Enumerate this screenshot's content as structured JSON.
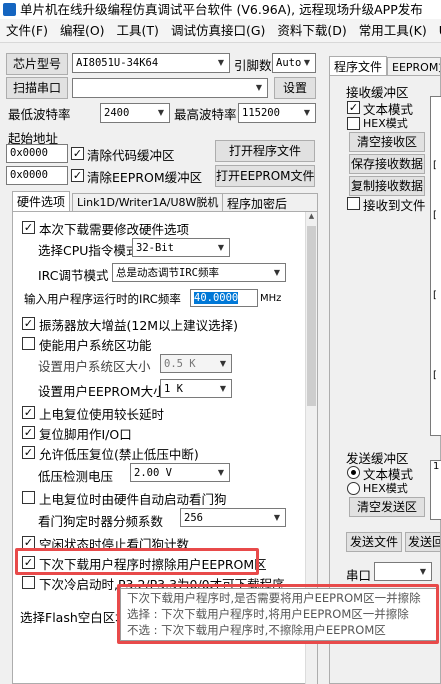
{
  "window": {
    "title": "单片机在线升级编程仿真调试平台软件 (V6.96A), 远程现场升级APP发布"
  },
  "menubar": [
    "文件(F)",
    "编程(O)",
    "工具(T)",
    "调试仿真接口(G)",
    "资料下载(D)",
    "常用工具(K)",
    "US"
  ],
  "chip": {
    "button": "芯片型号",
    "value": "AI8051U-34K64",
    "pin_label": "引脚数",
    "pin_value": "Auto"
  },
  "port": {
    "button": "扫描串口",
    "settings_button": "设置"
  },
  "baud": {
    "min_label": "最低波特率",
    "min_value": "2400",
    "max_label": "最高波特率",
    "max_value": "115200"
  },
  "addr": {
    "label": "起始地址",
    "addr1": "0x0000",
    "clear_code": "清除代码缓冲区",
    "open_program": "打开程序文件",
    "addr2": "0x0000",
    "clear_eeprom": "清除EEPROM缓冲区",
    "open_eeprom": "打开EEPROM文件"
  },
  "tabs": [
    "硬件选项",
    "Link1D/Writer1A/U8W脱机",
    "程序加密后"
  ],
  "hw": {
    "modify": "本次下载需要修改硬件选项",
    "cpu_label": "选择CPU指令模式",
    "cpu_value": "32-Bit",
    "irc_label": "IRC调节模式",
    "irc_value": "总是动态调节IRC频率",
    "freq_label": "输入用户程序运行时的IRC频率",
    "freq_value": "40.0000",
    "freq_unit": "MHz",
    "osc": "振荡器放大增益(12M以上建议选择)",
    "sysarea": "使能用户系统区功能",
    "sysarea_size_label": "设置用户系统区大小",
    "sysarea_size_value": "0.5 K",
    "eeprom_size_label": "设置用户EEPROM大小",
    "eeprom_size_value": "1  K",
    "longreset": "上电复位使用较长延时",
    "resetio": "复位脚用作I/O口",
    "lowvolt": "允许低压复位(禁止低压中断)",
    "lowvolt_label": "低压检测电压",
    "lowvolt_value": "2.00 V",
    "wdt_start": "上电复位时由硬件自动启动看门狗",
    "wdt_div_label": "看门狗定时器分频系数",
    "wdt_div_value": "256",
    "idle_wdt": "空闲状态时停止看门狗计数",
    "erase_eeprom": "下次下载用户程序时擦除用户EEPROM区",
    "next_cold": "下次冷启动时,P3.2/P3.3为0/0才可下载程序",
    "flash_fill": "选择Flash空白区域"
  },
  "right": {
    "tabs": [
      "程序文件",
      "EEPROM文"
    ],
    "recv_title": "接收缓冲区",
    "recv_text": "文本模式",
    "recv_hex": "HEX模式",
    "clear_recv": "清空接收区",
    "save_recv": "保存接收数据",
    "copy_recv": "复制接收数据",
    "recv_to_file": "接收到文件",
    "send_title": "发送缓冲区",
    "send_text": "文本模式",
    "send_hex": "HEX模式",
    "clear_send": "清空发送区",
    "send_file": "发送文件",
    "send_back": "发送回",
    "port_label": "串口",
    "side_digit": "1",
    "marks": [
      "[",
      "[",
      "[",
      "["
    ]
  },
  "tooltip": [
    "下次下载用户程序时,是否需要将用户EEPROM区一并擦除",
    "选择 : 下次下载用户程序时,将用户EEPROM区一并擦除",
    "不选 : 下次下载用户程序时,不擦除用户EEPROM区"
  ],
  "colors": {
    "highlight": "#e84a4a",
    "selection": "#0078d7"
  }
}
